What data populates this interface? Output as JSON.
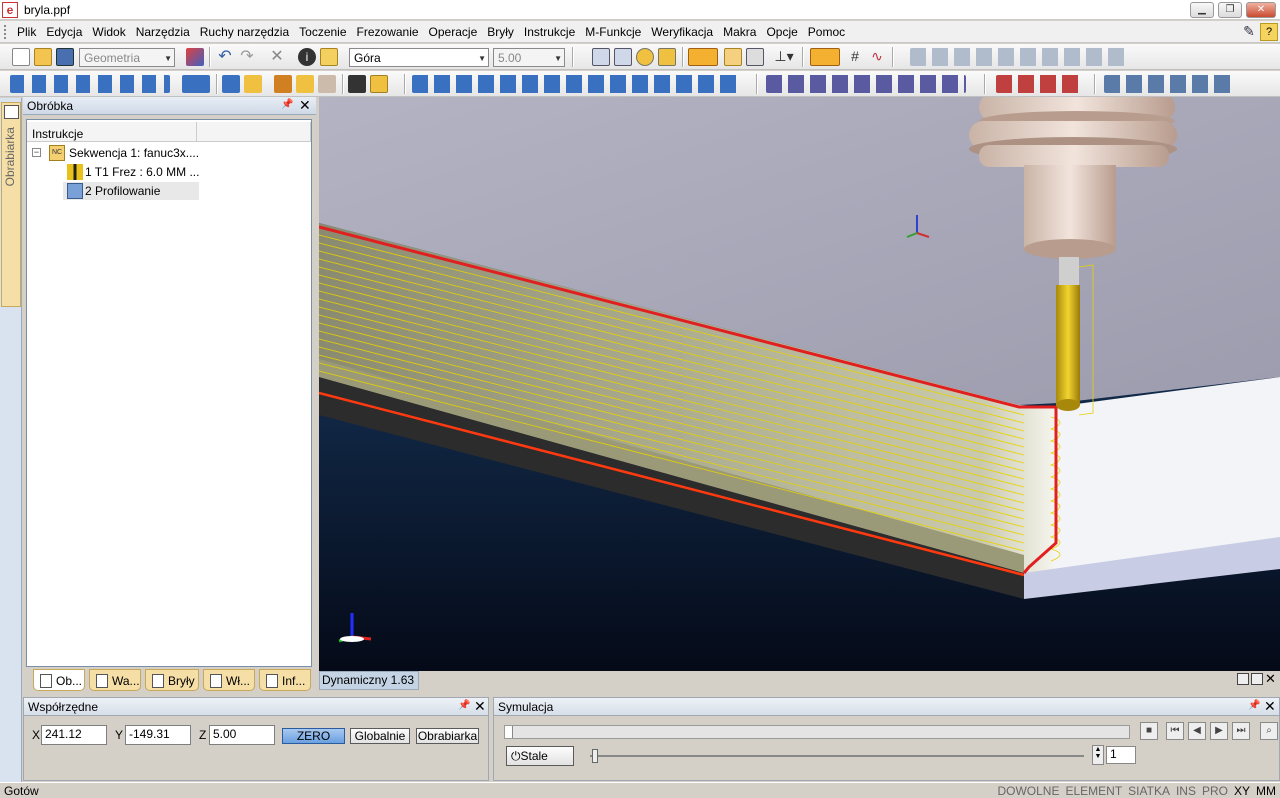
{
  "window": {
    "title": "bryla.ppf",
    "app_icon": "e"
  },
  "menu": [
    "Plik",
    "Edycja",
    "Widok",
    "Narzędzia",
    "Ruchy narzędzia",
    "Toczenie",
    "Frezowanie",
    "Operacje",
    "Bryły",
    "Instrukcje",
    "M-Funkcje",
    "Weryfikacja",
    "Makra",
    "Opcje",
    "Pomoc"
  ],
  "toolbar1": {
    "layer_combo": "Geometria",
    "view_combo": "Góra",
    "value_combo": "5.00"
  },
  "leftrail": {
    "tab_label": "Obrabiarka"
  },
  "obrobka": {
    "title": "Obróbka",
    "column": "Instrukcje",
    "rows": [
      "Sekwencja 1: fanuc3x....",
      "1 T1 Frez : 6.0 MM ...",
      "2 Profilowanie"
    ],
    "tabs": [
      "Ob...",
      "Wa...",
      "Bryły",
      "Wł...",
      "Inf..."
    ]
  },
  "viewport": {
    "status": "Dynamiczny 1.63"
  },
  "wsp": {
    "title": "Współrzędne",
    "x_label": "X",
    "x": "241.12",
    "y_label": "Y",
    "y": "-149.31",
    "z_label": "Z",
    "z": "5.00",
    "zero": "ZERO",
    "globalnie": "Globalnie",
    "obrabiarka": "Obrabiarka"
  },
  "sym": {
    "title": "Symulacja",
    "mode": "Stale",
    "step": "1"
  },
  "status": {
    "left": "Gotów",
    "flags": [
      "DOWOLNE",
      "ELEMENT",
      "SIATKA",
      "INS",
      "PRO",
      "XY",
      "MM"
    ]
  },
  "colors": {
    "accent": "#3a78d0",
    "tool": "#e8c21a",
    "part_edge": "#e02020"
  }
}
